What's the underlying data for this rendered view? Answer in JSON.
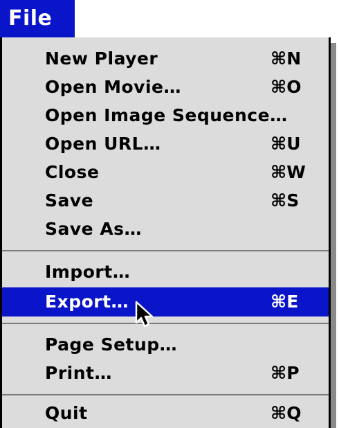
{
  "menu": {
    "title": "File",
    "items": [
      {
        "label": "New Player",
        "shortcut": "⌘N"
      },
      {
        "label": "Open Movie…",
        "shortcut": "⌘O"
      },
      {
        "label": "Open Image Sequence…",
        "shortcut": ""
      },
      {
        "label": "Open URL…",
        "shortcut": "⌘U"
      },
      {
        "label": "Close",
        "shortcut": "⌘W"
      },
      {
        "label": "Save",
        "shortcut": "⌘S"
      },
      {
        "label": "Save As…",
        "shortcut": ""
      },
      {
        "label": "Import…",
        "shortcut": ""
      },
      {
        "label": "Export…",
        "shortcut": "⌘E",
        "highlighted": true
      },
      {
        "label": "Page Setup…",
        "shortcut": ""
      },
      {
        "label": "Print…",
        "shortcut": "⌘P"
      },
      {
        "label": "Quit",
        "shortcut": "⌘Q"
      }
    ]
  },
  "colors": {
    "highlight": "#0a14c8",
    "menu_background": "#dcdcdc",
    "highlight_text": "#ffffff"
  },
  "cursor_icon": "arrow-pointer-icon"
}
